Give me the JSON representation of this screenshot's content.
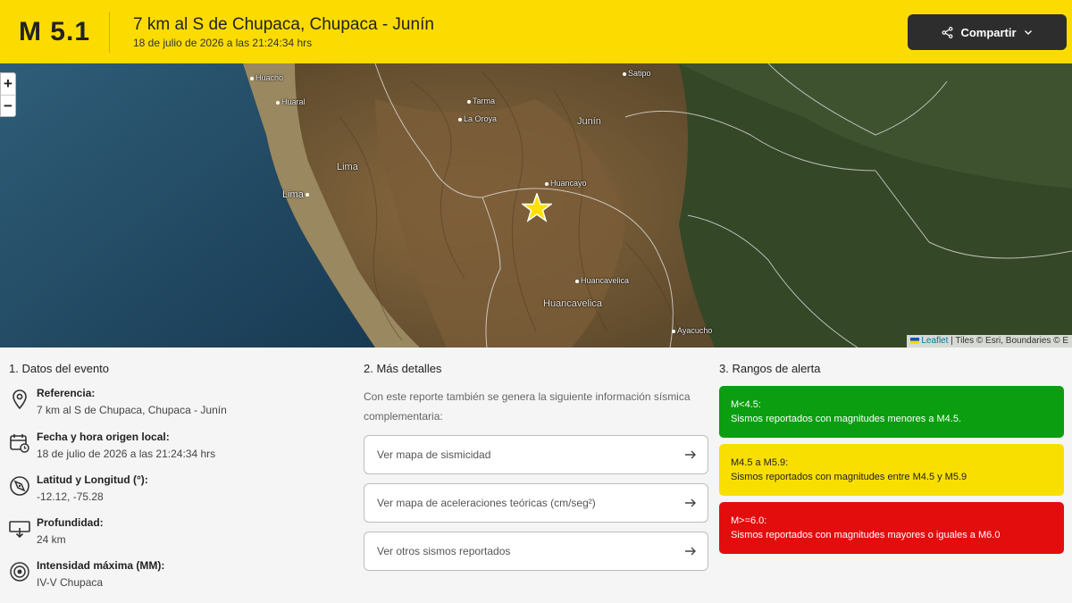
{
  "header": {
    "magnitude": "M 5.1",
    "title": "7 km al S de Chupaca, Chupaca - Junín",
    "datetime": "18 de julio de 2026 a las 21:24:34 hrs",
    "share_label": "Compartir"
  },
  "map": {
    "zoom_in": "+",
    "zoom_out": "−",
    "attribution_link": "Leaflet",
    "attribution_text": " | Tiles © Esri, Boundaries © E",
    "places": {
      "satipo": "Satipo",
      "huacho": "Huacho",
      "huaral": "Huaral",
      "tarma": "Tarma",
      "la_oroya": "La Oroya",
      "junin": "Junín",
      "lima_region": "Lima",
      "lima_city": "Lima",
      "huancayo": "Huancayo",
      "huancavelica_city": "Huancavelica",
      "huancavelica_region": "Huancavelica",
      "ayacucho": "Ayacucho"
    }
  },
  "event": {
    "section_title": "1. Datos del evento",
    "items": [
      {
        "label": "Referencia:",
        "value": "7 km al S de Chupaca, Chupaca - Junín",
        "icon": "location-pin-icon"
      },
      {
        "label": "Fecha y hora origen local:",
        "value": "18 de julio de 2026 a las 21:24:34 hrs",
        "icon": "calendar-clock-icon"
      },
      {
        "label": "Latitud y Longitud (°):",
        "value": "-12.12, -75.28",
        "icon": "compass-icon"
      },
      {
        "label": "Profundidad:",
        "value": "24 km",
        "icon": "depth-icon"
      },
      {
        "label": "Intensidad máxima (MM):",
        "value": "IV-V Chupaca",
        "icon": "intensity-icon"
      }
    ]
  },
  "details": {
    "section_title": "2. Más detalles",
    "description": "Con este reporte también se genera la siguiente información sísmica complementaria:",
    "links": [
      "Ver mapa de sismicidad",
      "Ver mapa de aceleraciones teóricas (cm/seg²)",
      "Ver otros sismos reportados"
    ]
  },
  "alerts": {
    "section_title": "3. Rangos de alerta",
    "ranges": [
      {
        "range": "M<4.5:",
        "text": "Sismos reportados con magnitudes menores a M4.5.",
        "color": "#0a9e10"
      },
      {
        "range": "M4.5 a M5.9:",
        "text": "Sismos reportados con magnitudes entre M4.5 y M5.9",
        "color": "#f8df00"
      },
      {
        "range": "M>=6.0:",
        "text": "Sismos reportados con magnitudes mayores o iguales a M6.0",
        "color": "#e30d0d"
      }
    ]
  }
}
